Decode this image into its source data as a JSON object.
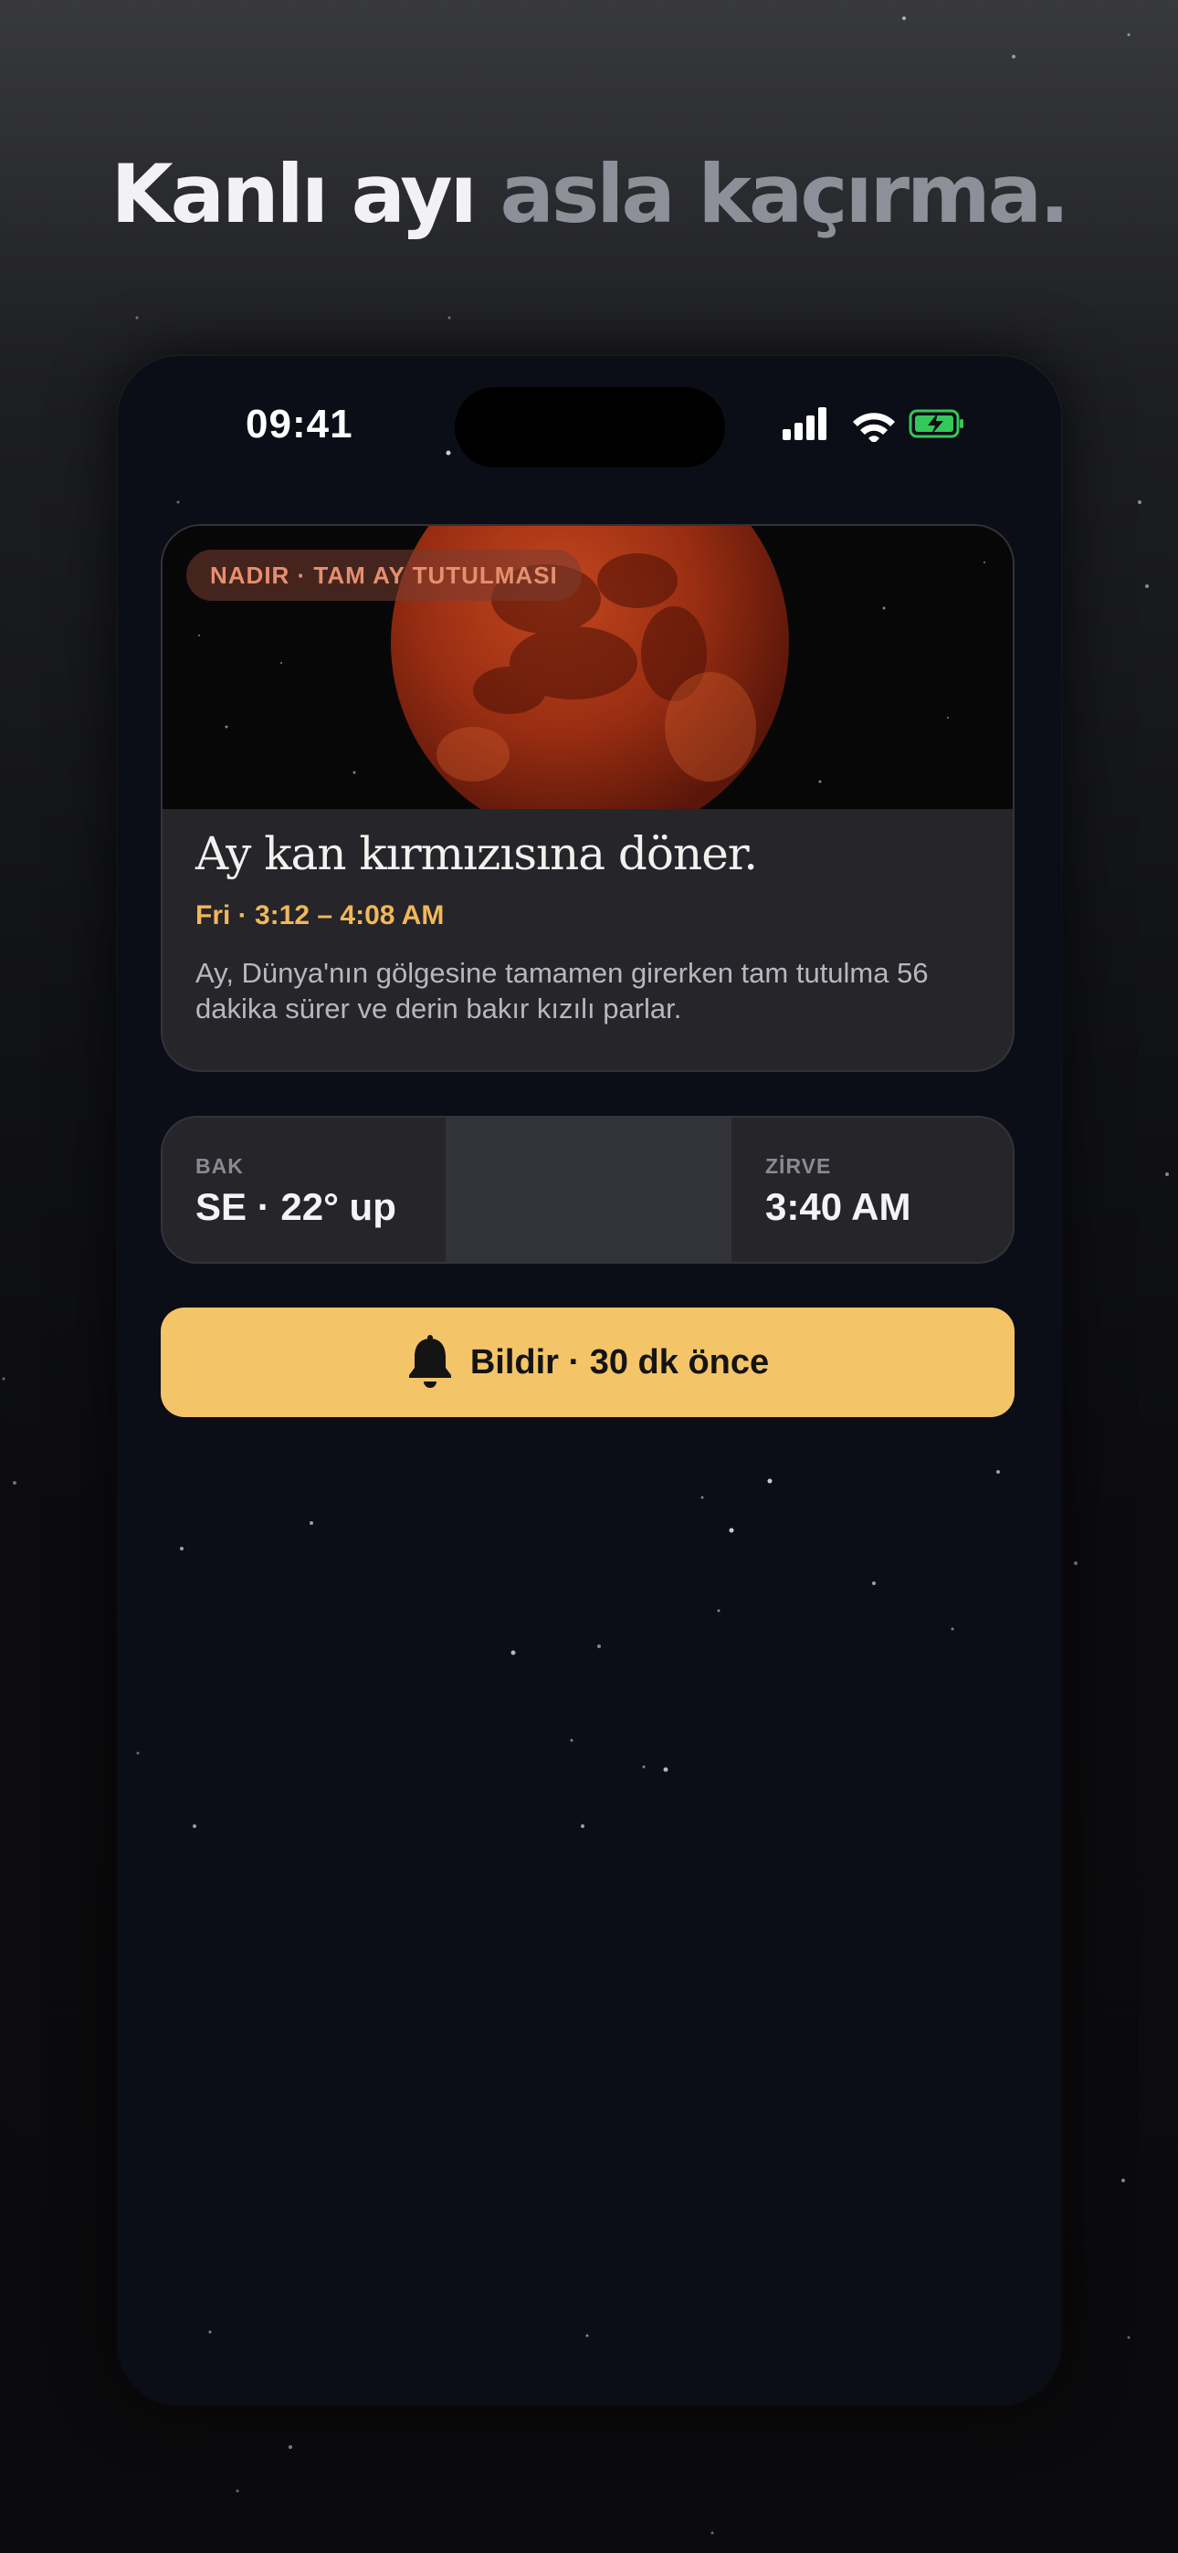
{
  "headline": {
    "part1": "Kanlı ayı",
    "part2": "asla kaçırma."
  },
  "status_bar": {
    "time": "09:41",
    "icons": [
      "signal-icon",
      "wifi-icon",
      "battery-charging-icon"
    ]
  },
  "event_card": {
    "badge": "NADIR · TAM AY TUTULMASI",
    "title": "Ay kan kırmızısına döner.",
    "time": "Fri · 3:12 – 4:08 AM",
    "description": "Ay, Dünya'nın gölgesine tamamen girerken tam tutulma 56 dakika sürer ve derin bakır kızılı parlar."
  },
  "info_row": {
    "look_label": "BAK",
    "look_value": "SE · 22° up",
    "peak_label": "ZİRVE",
    "peak_value": "3:40 AM"
  },
  "notify_button": {
    "label": "Bildir · 30 dk önce",
    "icon": "bell-icon"
  },
  "colors": {
    "accent_yellow": "#f4c468",
    "badge_text": "#e68f6e",
    "time_text": "#f1b75a",
    "phone_bg": "#0b0d17",
    "card_bg": "#25252a"
  }
}
